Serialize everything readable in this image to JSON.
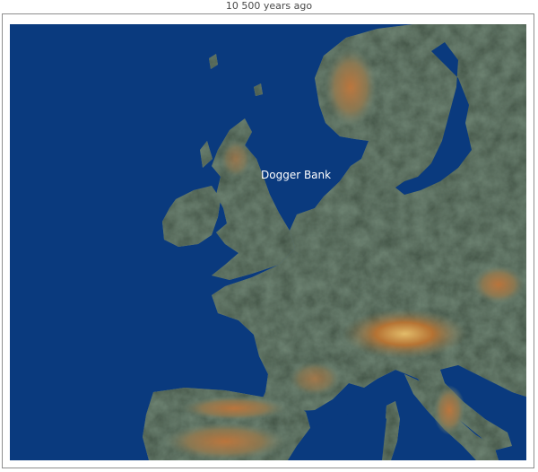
{
  "caption": "10 500 years ago",
  "map": {
    "label": "Dogger Bank",
    "colors": {
      "sea": "#0a3a7e",
      "land": "#6f8574",
      "highland": "#8c7a52",
      "mountain": "#b86b2c",
      "peak": "#e0b25a"
    }
  }
}
